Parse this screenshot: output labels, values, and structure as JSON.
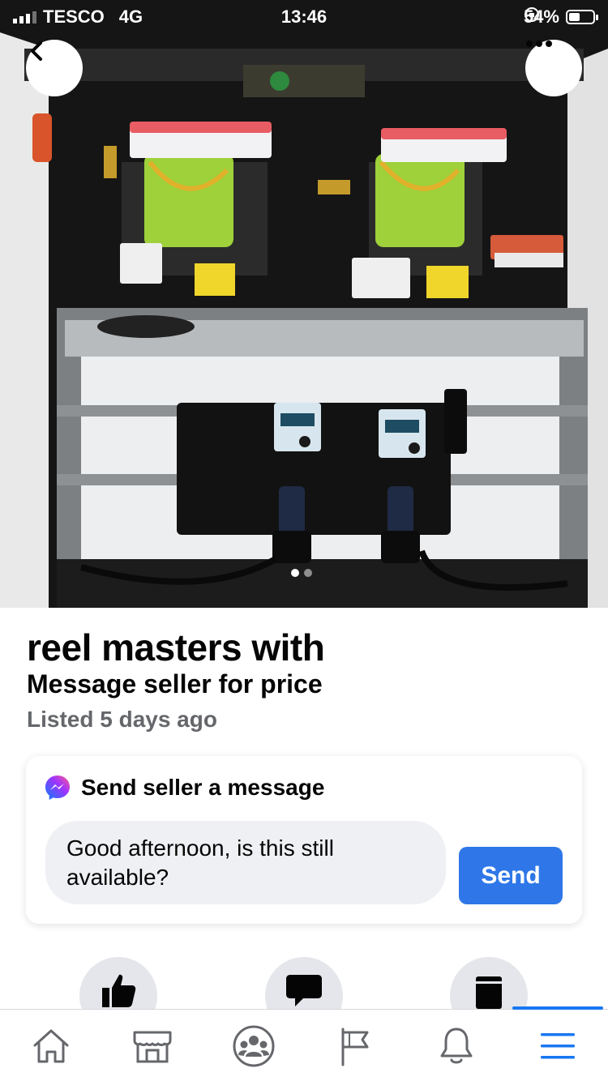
{
  "status_bar": {
    "carrier": "TESCO",
    "network": "4G",
    "time": "13:46",
    "battery": "54%",
    "battery_level": 0.54
  },
  "gallery": {
    "photo_count": 2,
    "current_index": 1,
    "back_icon": "chevron-left-icon",
    "more_icon": "ellipsis-icon"
  },
  "listing": {
    "title": "reel masters with",
    "price": "Message seller for price",
    "listed": "Listed 5 days ago"
  },
  "message": {
    "heading": "Send seller a message",
    "icon": "messenger-icon",
    "input_value": "Good afternoon, is this still available?",
    "send_label": "Send"
  },
  "actions": [
    {
      "icon": "like-icon"
    },
    {
      "icon": "message-icon"
    },
    {
      "icon": "save-icon"
    }
  ],
  "tabs": [
    {
      "icon": "home-icon"
    },
    {
      "icon": "marketplace-icon"
    },
    {
      "icon": "groups-icon"
    },
    {
      "icon": "pages-flag-icon"
    },
    {
      "icon": "notifications-bell-icon"
    },
    {
      "icon": "menu-icon",
      "active": true
    }
  ],
  "colors": {
    "accent": "#1877f2",
    "send_button": "#2f77e8",
    "muted_text": "#65676b",
    "input_bg": "#eff0f3"
  }
}
